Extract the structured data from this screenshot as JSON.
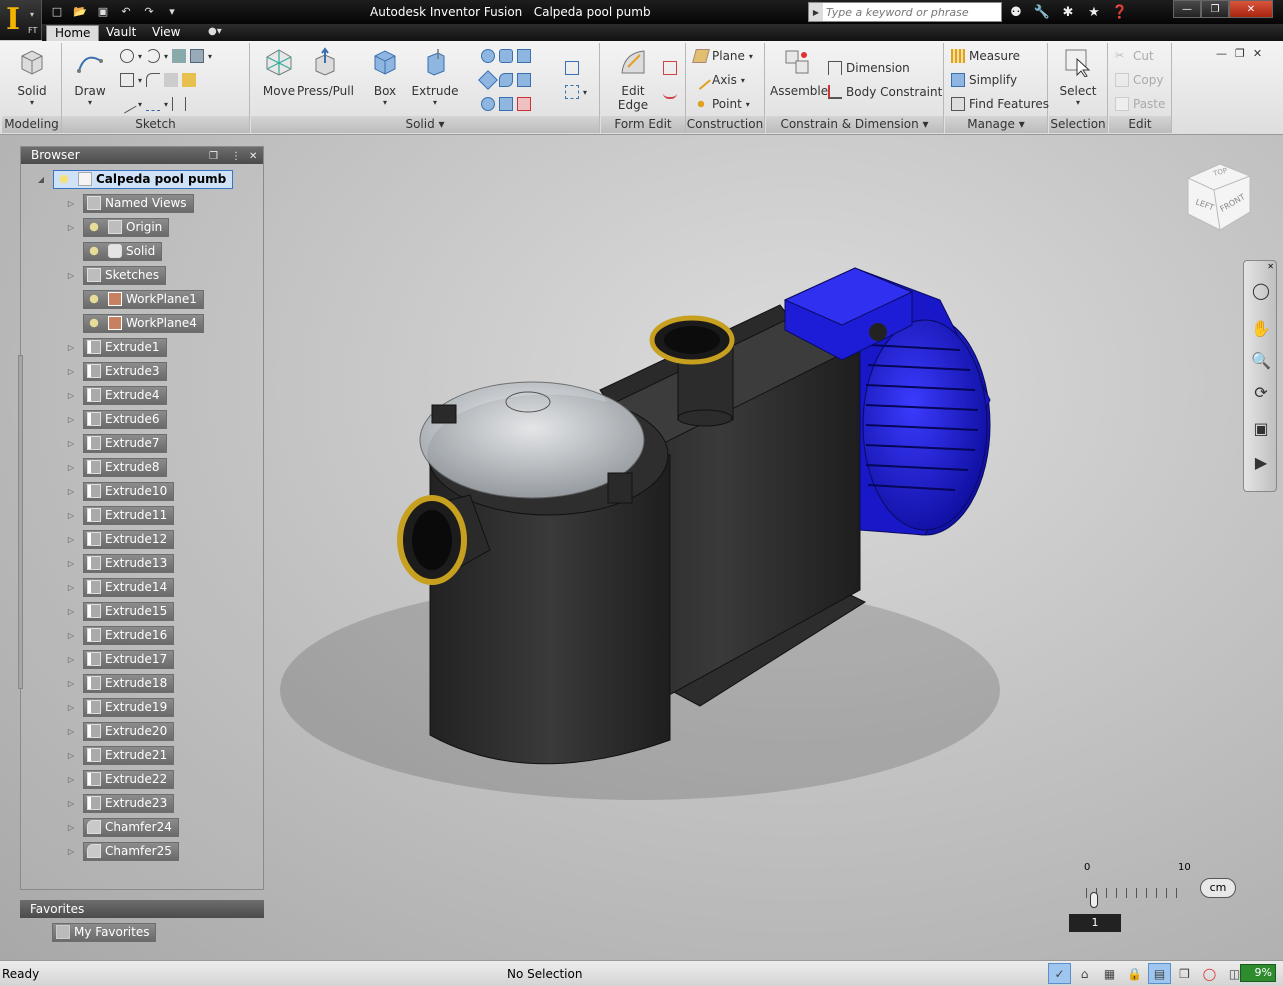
{
  "app": {
    "logo_letter": "I",
    "logo_sub": "FT",
    "title": "Autodesk Inventor Fusion   Calpeda pool pumb"
  },
  "search": {
    "placeholder": "Type a keyword or phrase"
  },
  "tabs": [
    {
      "label": "Home",
      "active": true
    },
    {
      "label": "Vault",
      "active": false
    },
    {
      "label": "View",
      "active": false
    }
  ],
  "ribbon": {
    "modeling": {
      "label": "Modeling",
      "solid": "Solid"
    },
    "sketch": {
      "label": "Sketch",
      "draw": "Draw"
    },
    "solid": {
      "label": "Solid",
      "move": "Move",
      "presspull": "Press/Pull",
      "box": "Box",
      "extrude": "Extrude"
    },
    "formedit": {
      "label": "Form Edit",
      "editedge": "Edit Edge"
    },
    "construction": {
      "label": "Construction",
      "plane": "Plane",
      "axis": "Axis",
      "point": "Point"
    },
    "constrain": {
      "label": "Constrain & Dimension",
      "assemble": "Assemble",
      "dimension": "Dimension",
      "body_constraint": "Body Constraint"
    },
    "manage": {
      "label": "Manage",
      "measure": "Measure",
      "simplify": "Simplify",
      "find_features": "Find Features"
    },
    "selection": {
      "label": "Selection",
      "select": "Select"
    },
    "edit": {
      "label": "Edit",
      "cut": "Cut",
      "copy": "Copy",
      "paste": "Paste"
    }
  },
  "browser": {
    "title": "Browser",
    "root": "Calpeda pool pumb",
    "items": [
      {
        "label": "Named Views",
        "icon": "folder-icon",
        "expandable": true
      },
      {
        "label": "Origin",
        "icon": "folder-icon",
        "expandable": true,
        "bulb": true
      },
      {
        "label": "Solid",
        "icon": "solid-body-icon",
        "expandable": false,
        "bulb": true
      },
      {
        "label": "Sketches",
        "icon": "folder-icon",
        "expandable": true
      },
      {
        "label": "WorkPlane1",
        "icon": "workplane-icon",
        "expandable": false,
        "bulb": true
      },
      {
        "label": "WorkPlane4",
        "icon": "workplane-icon",
        "expandable": false,
        "bulb": true
      },
      {
        "label": "Extrude1",
        "icon": "extrude-icon",
        "expandable": true
      },
      {
        "label": "Extrude3",
        "icon": "extrude-icon",
        "expandable": true
      },
      {
        "label": "Extrude4",
        "icon": "extrude-icon",
        "expandable": true
      },
      {
        "label": "Extrude6",
        "icon": "extrude-icon",
        "expandable": true
      },
      {
        "label": "Extrude7",
        "icon": "extrude-icon",
        "expandable": true
      },
      {
        "label": "Extrude8",
        "icon": "extrude-icon",
        "expandable": true
      },
      {
        "label": "Extrude10",
        "icon": "extrude-icon",
        "expandable": true
      },
      {
        "label": "Extrude11",
        "icon": "extrude-icon",
        "expandable": true
      },
      {
        "label": "Extrude12",
        "icon": "extrude-icon",
        "expandable": true
      },
      {
        "label": "Extrude13",
        "icon": "extrude-icon",
        "expandable": true
      },
      {
        "label": "Extrude14",
        "icon": "extrude-icon",
        "expandable": true
      },
      {
        "label": "Extrude15",
        "icon": "extrude-icon",
        "expandable": true
      },
      {
        "label": "Extrude16",
        "icon": "extrude-icon",
        "expandable": true
      },
      {
        "label": "Extrude17",
        "icon": "extrude-icon",
        "expandable": true
      },
      {
        "label": "Extrude18",
        "icon": "extrude-icon",
        "expandable": true
      },
      {
        "label": "Extrude19",
        "icon": "extrude-icon",
        "expandable": true
      },
      {
        "label": "Extrude20",
        "icon": "extrude-icon",
        "expandable": true
      },
      {
        "label": "Extrude21",
        "icon": "extrude-icon",
        "expandable": true
      },
      {
        "label": "Extrude22",
        "icon": "extrude-icon",
        "expandable": true
      },
      {
        "label": "Extrude23",
        "icon": "extrude-icon",
        "expandable": true
      },
      {
        "label": "Chamfer24",
        "icon": "chamfer-icon",
        "expandable": true
      },
      {
        "label": "Chamfer25",
        "icon": "chamfer-icon",
        "expandable": true
      }
    ]
  },
  "favorites": {
    "title": "Favorites",
    "item": "My Favorites"
  },
  "viewcube": {
    "top": "TOP",
    "left": "LEFT",
    "front": "FRONT"
  },
  "scale": {
    "min": "0",
    "max": "10",
    "unit": "cm",
    "value": "1"
  },
  "status": {
    "left": "Ready",
    "middle": "No Selection",
    "zoom": "9%"
  },
  "colors": {
    "accent": "#3a74c4",
    "motor": "#1c1cd8",
    "body": "#2e2e2e",
    "ring": "#c8a020"
  }
}
